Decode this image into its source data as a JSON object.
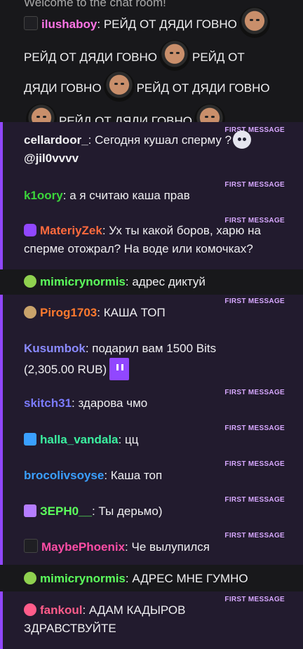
{
  "welcome": "Welcome to the chat room!",
  "first_message_label": "FIRST MESSAGE",
  "messages": [
    {
      "user": "ilushaboy",
      "color": "#ff75e6",
      "line1": "РЕЙД ОТ ДЯДИ ГОВНО",
      "line2a": "РЕЙД ОТ ДЯДИ ГОВНО",
      "line2b": "РЕЙД ОТ",
      "line3a": "ДЯДИ ГОВНО",
      "line3b": "РЕЙД ОТ ДЯДИ ГОВНО",
      "line4": "РЕЙД ОТ ДЯДИ ГОВНО"
    },
    {
      "user": "cellardoor_",
      "color": "#efeff1",
      "text": "Сегодня кушал сперму ?",
      "text2": "@jil0vvvv"
    },
    {
      "user": "k1oory",
      "color": "#3bd63b",
      "text": "а я считаю каша прав"
    },
    {
      "user": "MateriyZek",
      "color": "#ff6a3d",
      "text": "Ух ты какой боров, харю на",
      "text2": "сперме отожрал? На воде или комочках?"
    },
    {
      "user": "mimicrynormis",
      "color": "#5cff5c",
      "text": "адрес диктуй"
    },
    {
      "user": "Pirog1703",
      "color": "#ff7a2e",
      "text": "КАША ТОП"
    },
    {
      "user": "Kusumbok",
      "color": "#8a8aff",
      "text": "подарил вам 1500 Bits",
      "text2": "(2,305.00 RUB)"
    },
    {
      "user": "skitch31",
      "color": "#7b7bff",
      "text": "здарова чмо"
    },
    {
      "user": "halla_vandala",
      "color": "#3bf0a0",
      "text": "цц"
    },
    {
      "user": "brocolivsoyse",
      "color": "#3a9fff",
      "text": "Каша топ"
    },
    {
      "user": "ЗЕРН0__",
      "color": "#5cff5c",
      "text": "Ты дерьмо)"
    },
    {
      "user": "MaybePhoenix",
      "color": "#ff4da6",
      "text": "Че вылупился"
    },
    {
      "user": "mimicrynormis",
      "color": "#5cff5c",
      "text": "АДРЕС МНЕ ГУМНО"
    },
    {
      "user": "fankoul",
      "color": "#ff5c8a",
      "text": "АДАМ КАДЫРОВ",
      "text2": "ЗДРАВСТВУЙТЕ"
    }
  ]
}
